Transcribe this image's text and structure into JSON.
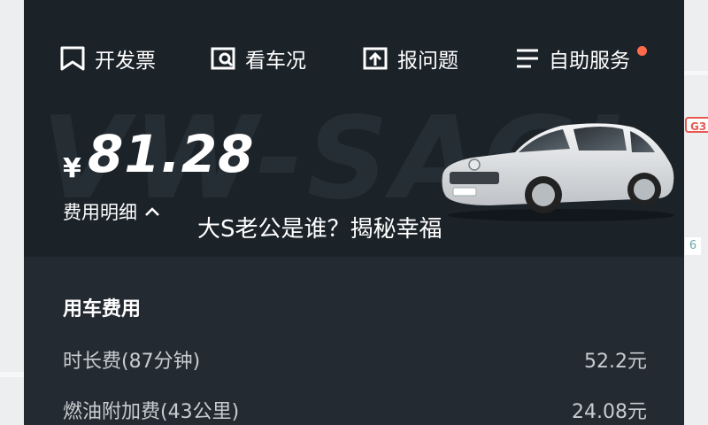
{
  "toolbar": {
    "invoice_label": "开发票",
    "inspect_label": "看车况",
    "report_label": "报问题",
    "service_label": "自助服务"
  },
  "watermark": "VW-SAGI",
  "price": {
    "currency": "¥",
    "amount": "81.28"
  },
  "detail_label": "费用明细",
  "banner_text": "大S老公是谁？揭秘幸福",
  "fees": {
    "section_title": "用车费用",
    "rows": [
      {
        "name": "时长费(87分钟)",
        "value": "52.2元"
      },
      {
        "name": "燃油附加费(43公里)",
        "value": "24.08元"
      }
    ]
  },
  "map": {
    "badge_1": "G3",
    "badge_2": "6"
  },
  "colors": {
    "card_bg": "#1b2228",
    "accent_dot": "#ff6b4a"
  }
}
